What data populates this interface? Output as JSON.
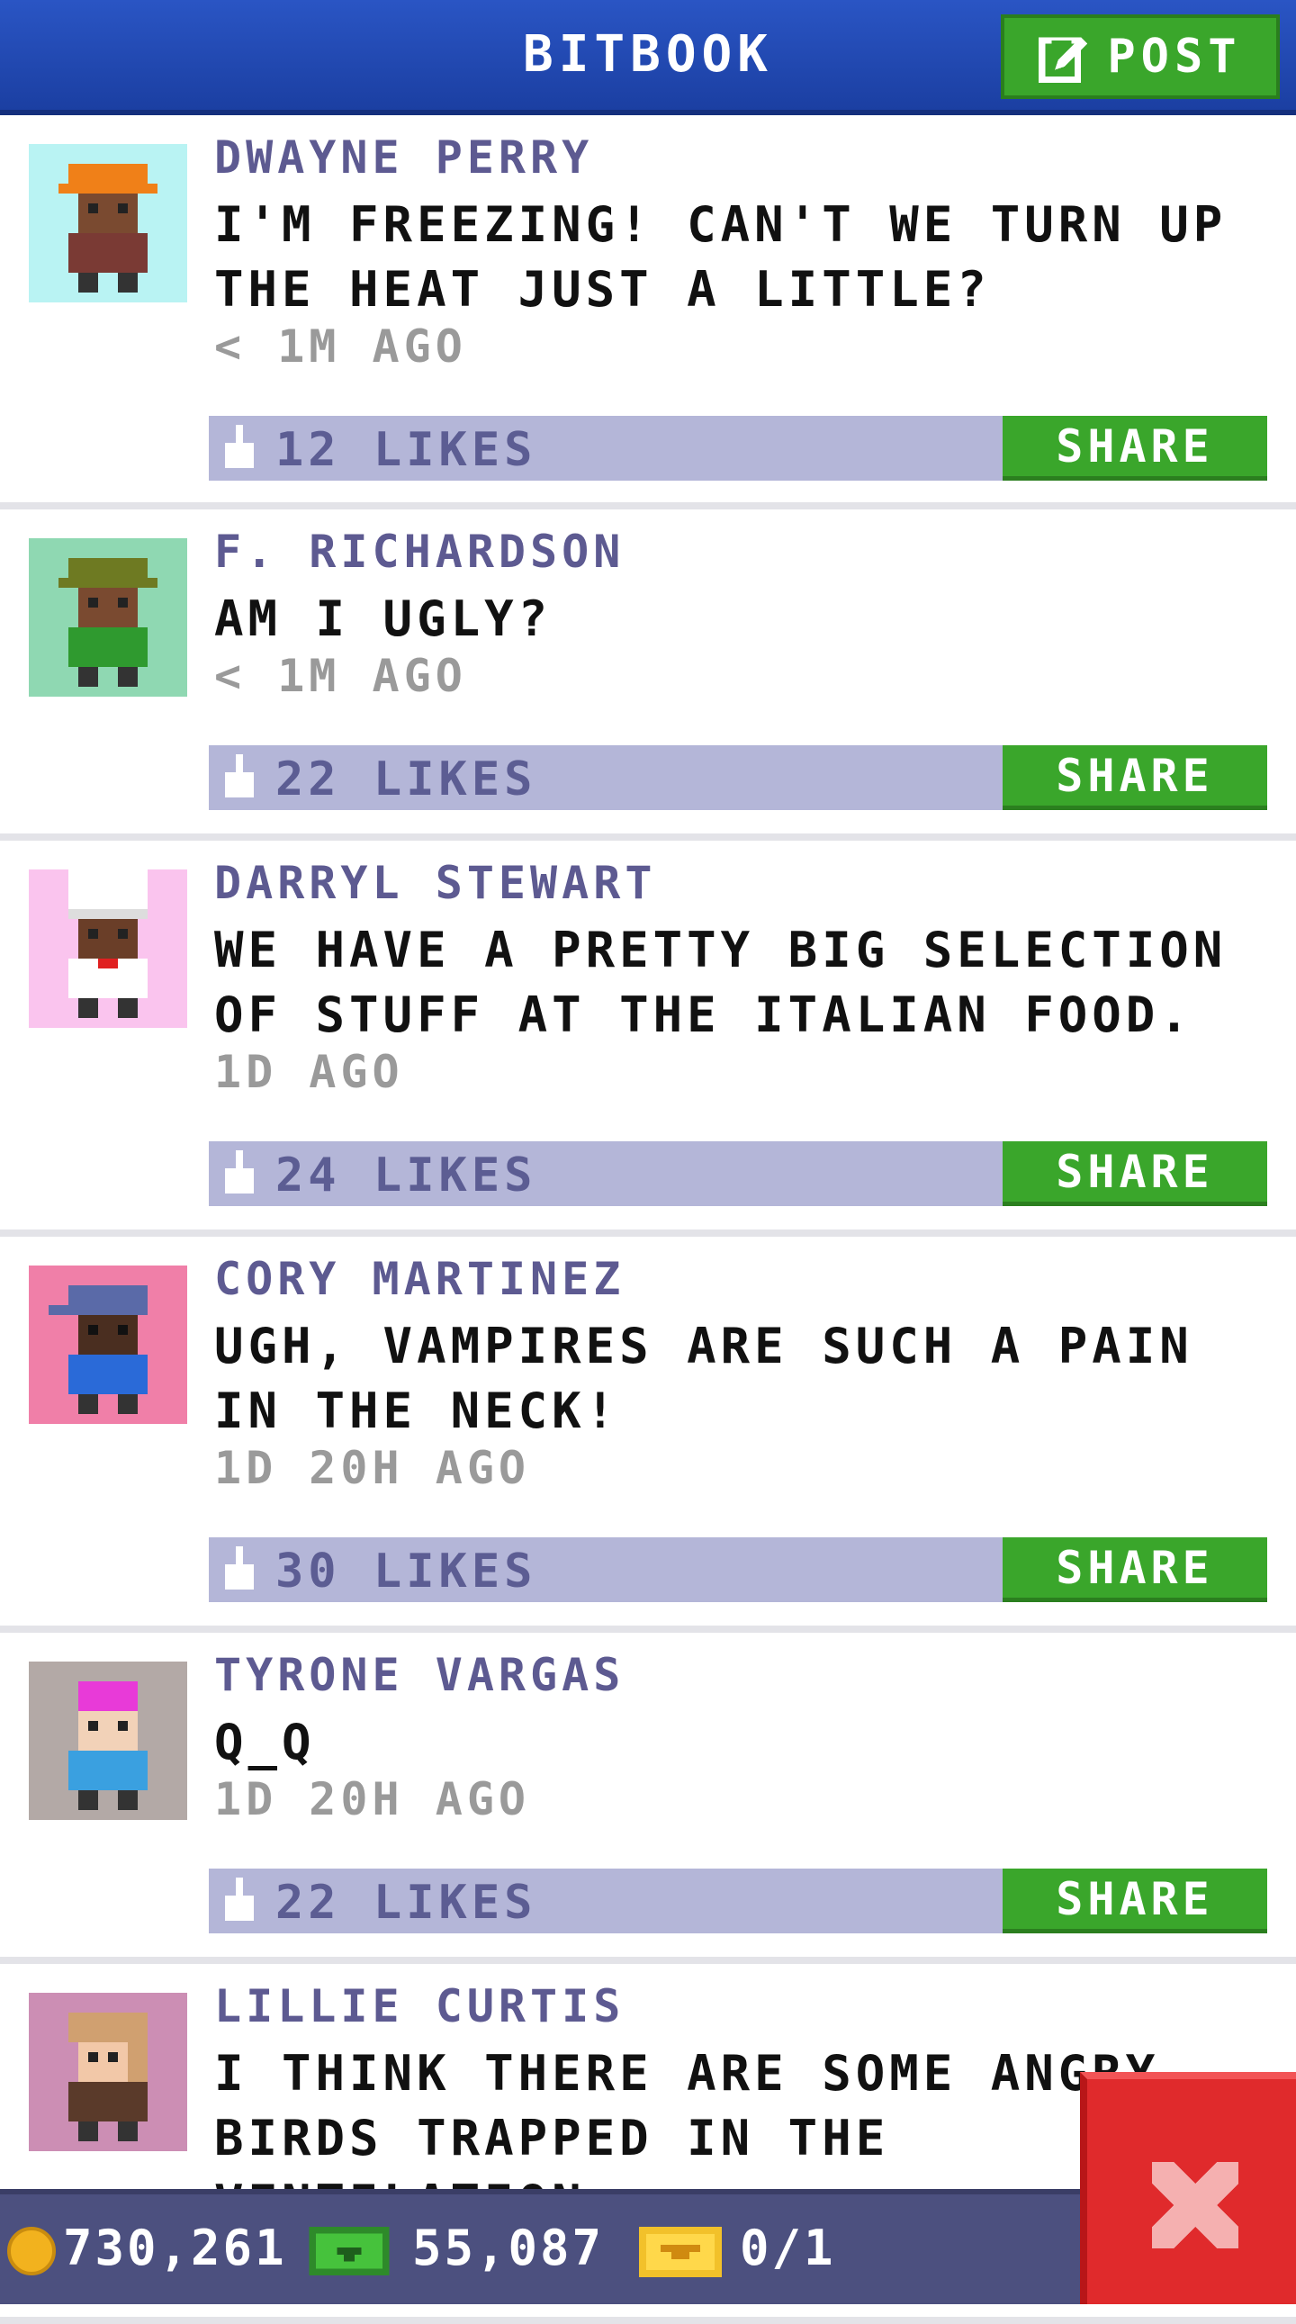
{
  "header": {
    "title": "BITBOOK",
    "post_label": "POST"
  },
  "posts": [
    {
      "author": "DWAYNE PERRY",
      "message": "I'M FREEZING! CAN'T WE TURN UP THE HEAT JUST A LITTLE?",
      "time": "< 1M AGO",
      "likes": "12 LIKES",
      "share": "SHARE",
      "avatar_bg": "#b9f3f3",
      "hat": "#f08018",
      "shirt": "#7a3a34",
      "skin": "#7a4a30"
    },
    {
      "author": "F. RICHARDSON",
      "message": "AM I UGLY?",
      "time": "< 1M AGO",
      "likes": "22 LIKES",
      "share": "SHARE",
      "avatar_bg": "#8fd8b2",
      "hat": "#6e7a22",
      "shirt": "#2f9a2f",
      "skin": "#7a4a30"
    },
    {
      "author": "DARRYL STEWART",
      "message": "WE HAVE A PRETTY BIG SELECTION OF STUFF AT THE ITALIAN FOOD.",
      "time": "1D AGO",
      "likes": "24 LIKES",
      "share": "SHARE",
      "avatar_bg": "#fac4ee",
      "hat": "#ffffff",
      "shirt": "#ffffff",
      "skin": "#6a3e28"
    },
    {
      "author": "CORY MARTINEZ",
      "message": "UGH, VAMPIRES ARE SUCH A PAIN IN THE NECK!",
      "time": "1D 20H AGO",
      "likes": "30 LIKES",
      "share": "SHARE",
      "avatar_bg": "#f07fa8",
      "hat": "#5a6aa8",
      "shirt": "#2a6ad8",
      "skin": "#4a2e20"
    },
    {
      "author": "TYRONE VARGAS",
      "message": "Q_Q",
      "time": "1D 20H AGO",
      "likes": "22 LIKES",
      "share": "SHARE",
      "avatar_bg": "#b3a9a6",
      "hat": "#e83ad8",
      "shirt": "#3aa0e0",
      "skin": "#f2d2b8"
    },
    {
      "author": "LILLIE CURTIS",
      "message": "I THINK THERE ARE SOME ANGRY BIRDS TRAPPED IN THE VENTILATION.",
      "time": "",
      "likes": "",
      "share": "",
      "avatar_bg": "#cc8eb4",
      "hat": "#d0a070",
      "shirt": "#5a3a2a",
      "skin": "#f2c8a8"
    }
  ],
  "currency": {
    "coins": "730,261",
    "bux": "55,087",
    "tickets": "0/1"
  },
  "colors": {
    "header": "#1b3fa2",
    "green": "#3aa62b",
    "likebar": "#b4b6d8",
    "close": "#e02a2c"
  },
  "icons": {
    "post": "edit-icon",
    "like": "thumbs-up-icon",
    "coin": "coin-icon",
    "bux": "bux-icon",
    "ticket": "ticket-icon",
    "close": "close-icon"
  }
}
